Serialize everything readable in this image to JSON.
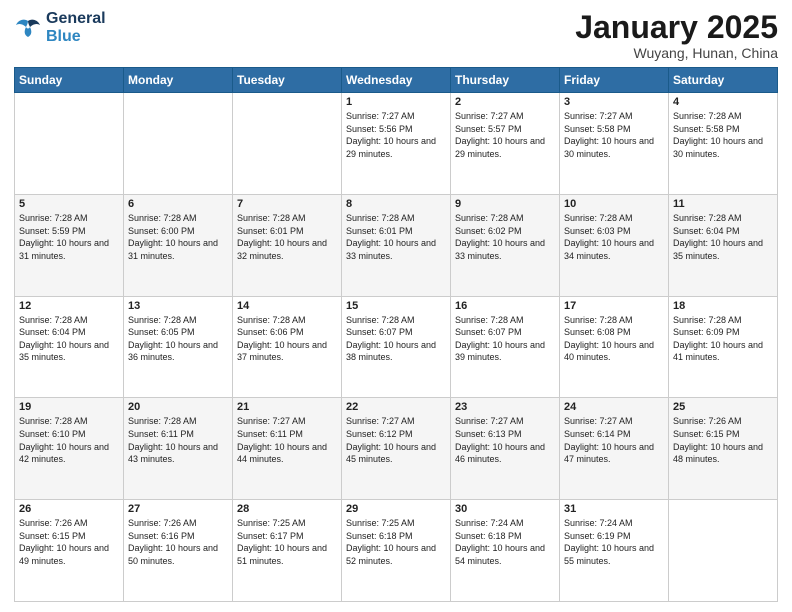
{
  "header": {
    "logo_line1": "General",
    "logo_line2": "Blue",
    "title": "January 2025",
    "subtitle": "Wuyang, Hunan, China"
  },
  "weekdays": [
    "Sunday",
    "Monday",
    "Tuesday",
    "Wednesday",
    "Thursday",
    "Friday",
    "Saturday"
  ],
  "weeks": [
    [
      {
        "day": "",
        "sunrise": "",
        "sunset": "",
        "daylight": ""
      },
      {
        "day": "",
        "sunrise": "",
        "sunset": "",
        "daylight": ""
      },
      {
        "day": "",
        "sunrise": "",
        "sunset": "",
        "daylight": ""
      },
      {
        "day": "1",
        "sunrise": "Sunrise: 7:27 AM",
        "sunset": "Sunset: 5:56 PM",
        "daylight": "Daylight: 10 hours and 29 minutes."
      },
      {
        "day": "2",
        "sunrise": "Sunrise: 7:27 AM",
        "sunset": "Sunset: 5:57 PM",
        "daylight": "Daylight: 10 hours and 29 minutes."
      },
      {
        "day": "3",
        "sunrise": "Sunrise: 7:27 AM",
        "sunset": "Sunset: 5:58 PM",
        "daylight": "Daylight: 10 hours and 30 minutes."
      },
      {
        "day": "4",
        "sunrise": "Sunrise: 7:28 AM",
        "sunset": "Sunset: 5:58 PM",
        "daylight": "Daylight: 10 hours and 30 minutes."
      }
    ],
    [
      {
        "day": "5",
        "sunrise": "Sunrise: 7:28 AM",
        "sunset": "Sunset: 5:59 PM",
        "daylight": "Daylight: 10 hours and 31 minutes."
      },
      {
        "day": "6",
        "sunrise": "Sunrise: 7:28 AM",
        "sunset": "Sunset: 6:00 PM",
        "daylight": "Daylight: 10 hours and 31 minutes."
      },
      {
        "day": "7",
        "sunrise": "Sunrise: 7:28 AM",
        "sunset": "Sunset: 6:01 PM",
        "daylight": "Daylight: 10 hours and 32 minutes."
      },
      {
        "day": "8",
        "sunrise": "Sunrise: 7:28 AM",
        "sunset": "Sunset: 6:01 PM",
        "daylight": "Daylight: 10 hours and 33 minutes."
      },
      {
        "day": "9",
        "sunrise": "Sunrise: 7:28 AM",
        "sunset": "Sunset: 6:02 PM",
        "daylight": "Daylight: 10 hours and 33 minutes."
      },
      {
        "day": "10",
        "sunrise": "Sunrise: 7:28 AM",
        "sunset": "Sunset: 6:03 PM",
        "daylight": "Daylight: 10 hours and 34 minutes."
      },
      {
        "day": "11",
        "sunrise": "Sunrise: 7:28 AM",
        "sunset": "Sunset: 6:04 PM",
        "daylight": "Daylight: 10 hours and 35 minutes."
      }
    ],
    [
      {
        "day": "12",
        "sunrise": "Sunrise: 7:28 AM",
        "sunset": "Sunset: 6:04 PM",
        "daylight": "Daylight: 10 hours and 35 minutes."
      },
      {
        "day": "13",
        "sunrise": "Sunrise: 7:28 AM",
        "sunset": "Sunset: 6:05 PM",
        "daylight": "Daylight: 10 hours and 36 minutes."
      },
      {
        "day": "14",
        "sunrise": "Sunrise: 7:28 AM",
        "sunset": "Sunset: 6:06 PM",
        "daylight": "Daylight: 10 hours and 37 minutes."
      },
      {
        "day": "15",
        "sunrise": "Sunrise: 7:28 AM",
        "sunset": "Sunset: 6:07 PM",
        "daylight": "Daylight: 10 hours and 38 minutes."
      },
      {
        "day": "16",
        "sunrise": "Sunrise: 7:28 AM",
        "sunset": "Sunset: 6:07 PM",
        "daylight": "Daylight: 10 hours and 39 minutes."
      },
      {
        "day": "17",
        "sunrise": "Sunrise: 7:28 AM",
        "sunset": "Sunset: 6:08 PM",
        "daylight": "Daylight: 10 hours and 40 minutes."
      },
      {
        "day": "18",
        "sunrise": "Sunrise: 7:28 AM",
        "sunset": "Sunset: 6:09 PM",
        "daylight": "Daylight: 10 hours and 41 minutes."
      }
    ],
    [
      {
        "day": "19",
        "sunrise": "Sunrise: 7:28 AM",
        "sunset": "Sunset: 6:10 PM",
        "daylight": "Daylight: 10 hours and 42 minutes."
      },
      {
        "day": "20",
        "sunrise": "Sunrise: 7:28 AM",
        "sunset": "Sunset: 6:11 PM",
        "daylight": "Daylight: 10 hours and 43 minutes."
      },
      {
        "day": "21",
        "sunrise": "Sunrise: 7:27 AM",
        "sunset": "Sunset: 6:11 PM",
        "daylight": "Daylight: 10 hours and 44 minutes."
      },
      {
        "day": "22",
        "sunrise": "Sunrise: 7:27 AM",
        "sunset": "Sunset: 6:12 PM",
        "daylight": "Daylight: 10 hours and 45 minutes."
      },
      {
        "day": "23",
        "sunrise": "Sunrise: 7:27 AM",
        "sunset": "Sunset: 6:13 PM",
        "daylight": "Daylight: 10 hours and 46 minutes."
      },
      {
        "day": "24",
        "sunrise": "Sunrise: 7:27 AM",
        "sunset": "Sunset: 6:14 PM",
        "daylight": "Daylight: 10 hours and 47 minutes."
      },
      {
        "day": "25",
        "sunrise": "Sunrise: 7:26 AM",
        "sunset": "Sunset: 6:15 PM",
        "daylight": "Daylight: 10 hours and 48 minutes."
      }
    ],
    [
      {
        "day": "26",
        "sunrise": "Sunrise: 7:26 AM",
        "sunset": "Sunset: 6:15 PM",
        "daylight": "Daylight: 10 hours and 49 minutes."
      },
      {
        "day": "27",
        "sunrise": "Sunrise: 7:26 AM",
        "sunset": "Sunset: 6:16 PM",
        "daylight": "Daylight: 10 hours and 50 minutes."
      },
      {
        "day": "28",
        "sunrise": "Sunrise: 7:25 AM",
        "sunset": "Sunset: 6:17 PM",
        "daylight": "Daylight: 10 hours and 51 minutes."
      },
      {
        "day": "29",
        "sunrise": "Sunrise: 7:25 AM",
        "sunset": "Sunset: 6:18 PM",
        "daylight": "Daylight: 10 hours and 52 minutes."
      },
      {
        "day": "30",
        "sunrise": "Sunrise: 7:24 AM",
        "sunset": "Sunset: 6:18 PM",
        "daylight": "Daylight: 10 hours and 54 minutes."
      },
      {
        "day": "31",
        "sunrise": "Sunrise: 7:24 AM",
        "sunset": "Sunset: 6:19 PM",
        "daylight": "Daylight: 10 hours and 55 minutes."
      },
      {
        "day": "",
        "sunrise": "",
        "sunset": "",
        "daylight": ""
      }
    ]
  ]
}
